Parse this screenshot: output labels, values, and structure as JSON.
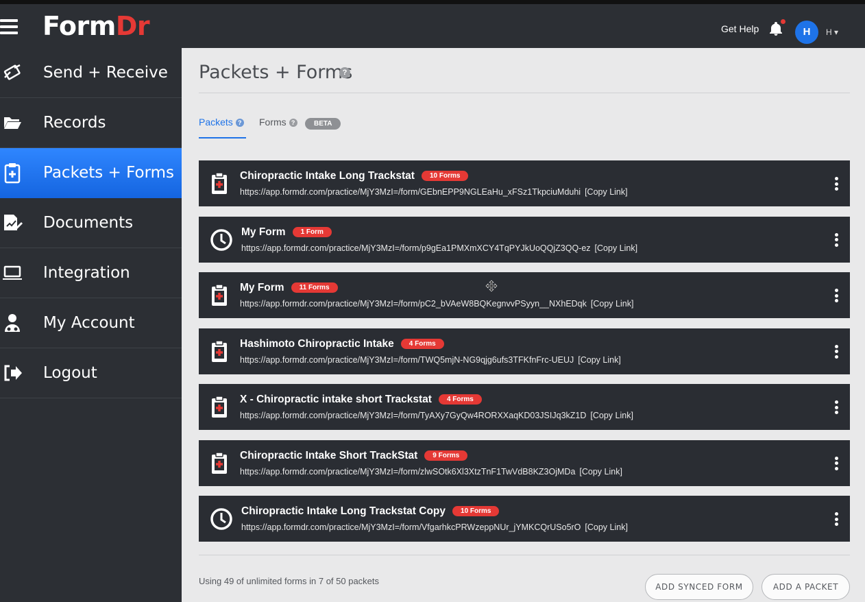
{
  "app": {
    "logo_form": "Form",
    "logo_dr": "Dr",
    "get_help": "Get Help",
    "avatar_initial": "H",
    "user_label": "H ▾"
  },
  "sidebar": {
    "items": [
      {
        "label": "Send + Receive",
        "icon": "send-receive-icon",
        "active": false
      },
      {
        "label": "Records",
        "icon": "folder-icon",
        "active": false
      },
      {
        "label": "Packets + Forms",
        "icon": "clipboard-plus-icon",
        "active": true
      },
      {
        "label": "Documents",
        "icon": "document-sign-icon",
        "active": false
      },
      {
        "label": "Integration",
        "icon": "laptop-icon",
        "active": false
      },
      {
        "label": "My Account",
        "icon": "user-icon",
        "active": false
      },
      {
        "label": "Logout",
        "icon": "logout-icon",
        "active": false
      }
    ]
  },
  "main": {
    "title": "Packets + Forms",
    "help": "?",
    "tabs": {
      "packets": "Packets",
      "forms": "Forms",
      "beta": "BETA"
    },
    "packets": [
      {
        "name": "Chiropractic Intake Long Trackstat",
        "badge": "10 Forms",
        "url": "https://app.formdr.com/practice/MjY3MzI=/form/GEbnEPP9NGLEaHu_xFSz1TkpciuMduhi",
        "copy": "[Copy Link]",
        "icon": "clipboard-icon"
      },
      {
        "name": "My Form",
        "badge": "1 Form",
        "url": "https://app.formdr.com/practice/MjY3MzI=/form/p9gEa1PMXmXCY4TqPYJkUoQQjZ3QQ-ez",
        "copy": "[Copy Link]",
        "icon": "clock-icon"
      },
      {
        "name": "My Form",
        "badge": "11 Forms",
        "url": "https://app.formdr.com/practice/MjY3MzI=/form/pC2_bVAeW8BQKegnvvPSyyn__NXhEDqk",
        "copy": "[Copy Link]",
        "icon": "clipboard-icon"
      },
      {
        "name": "Hashimoto Chiropractic Intake",
        "badge": "4 Forms",
        "url": "https://app.formdr.com/practice/MjY3MzI=/form/TWQ5mjN-NG9qjg6ufs3TFKfnFrc-UEUJ",
        "copy": "[Copy Link]",
        "icon": "clipboard-icon"
      },
      {
        "name": "X - Chiropractic intake short Trackstat",
        "badge": "4 Forms",
        "url": "https://app.formdr.com/practice/MjY3MzI=/form/TyAXy7GyQw4RORXXaqKD03JSIJq3kZ1D",
        "copy": "[Copy Link]",
        "icon": "clipboard-icon"
      },
      {
        "name": "Chiropractic Intake Short TrackStat",
        "badge": "9 Forms",
        "url": "https://app.formdr.com/practice/MjY3MzI=/form/zlwSOtk6Xl3XtzTnF1TwVdB8KZ3OjMDa",
        "copy": "[Copy Link]",
        "icon": "clipboard-icon"
      },
      {
        "name": "Chiropractic Intake Long Trackstat Copy",
        "badge": "10 Forms",
        "url": "https://app.formdr.com/practice/MjY3MzI=/form/VfgarhkcPRWzeppNUr_jYMKCQrUSo5rO",
        "copy": "[Copy Link]",
        "icon": "clock-icon"
      }
    ],
    "usage": "Using 49 of unlimited forms in 7 of 50 packets",
    "buttons": {
      "add_synced_form": "ADD SYNCED FORM",
      "add_packet": "ADD A PACKET"
    }
  },
  "colors": {
    "sidebar_bg": "#2c2f34",
    "active_blue": "#1e73e8",
    "badge_red": "#e53935",
    "packet_bg": "#2a2d33",
    "main_bg": "#e9e9ea"
  }
}
